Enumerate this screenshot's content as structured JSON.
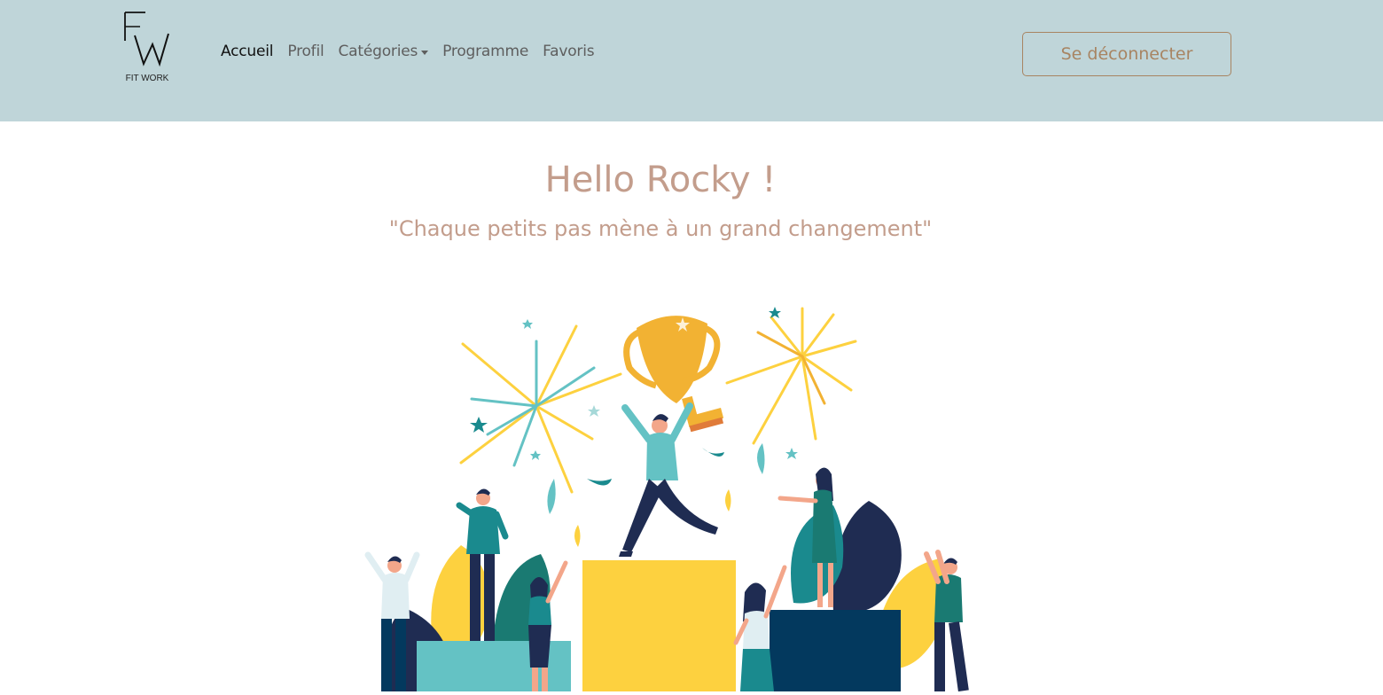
{
  "brand": {
    "logo_text": "FIT WORK",
    "logo_monogram": "FW"
  },
  "nav": {
    "items": [
      {
        "label": "Accueil",
        "active": true
      },
      {
        "label": "Profil"
      },
      {
        "label": "Catégories",
        "dropdown": true
      },
      {
        "label": "Programme"
      },
      {
        "label": "Favoris"
      }
    ],
    "logout_label": "Se déconnecter"
  },
  "hero": {
    "greeting": "Hello Rocky !",
    "quote": "\"Chaque petits pas mène à un grand changement\""
  },
  "colors": {
    "navbar_bg": "#bfd5d9",
    "accent": "#c39d8c",
    "button_border": "#a88462",
    "teal": "#64c2c4",
    "yellow": "#fdd13f",
    "navy": "#1f3b5a"
  },
  "illustration": {
    "name": "trophy-celebration-illustration"
  }
}
